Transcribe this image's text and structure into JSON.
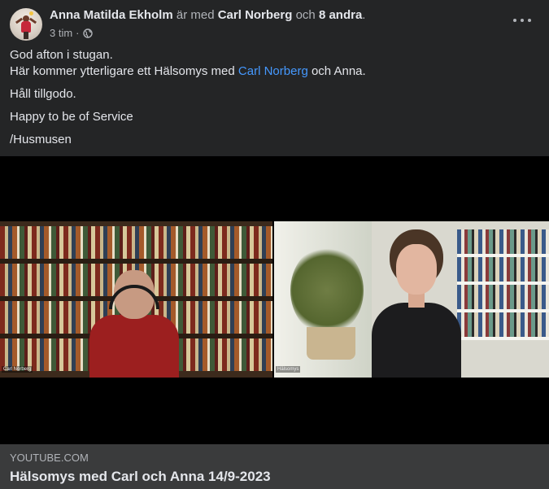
{
  "post": {
    "author": "Anna Matilda Ekholm",
    "with_text": "är med",
    "tagged_person": "Carl Norberg",
    "and_text": "och",
    "others": "8 andra",
    "period": ".",
    "time": "3 tim",
    "separator": "·",
    "audience_icon": "globe-icon",
    "more_icon": "more-options-icon"
  },
  "body": {
    "line1": "God afton i stugan.",
    "line2_prefix": "Här kommer ytterligare ett Hälsomys med",
    "line2_link": "Carl Norberg",
    "line2_suffix": "och Anna.",
    "line3": "Håll tillgodo.",
    "line4": "Happy to be of Service",
    "line5": "/Husmusen"
  },
  "video": {
    "left_name": "Carl Norberg",
    "right_name": "Hälsomys"
  },
  "link_preview": {
    "domain": "YOUTUBE.COM",
    "title": "Hälsomys med Carl och Anna 14/9-2023"
  },
  "colors": {
    "background": "#242526",
    "preview_background": "#3a3b3c",
    "text_primary": "#e4e6eb",
    "text_secondary": "#b0b3b8",
    "link": "#4599ff"
  }
}
